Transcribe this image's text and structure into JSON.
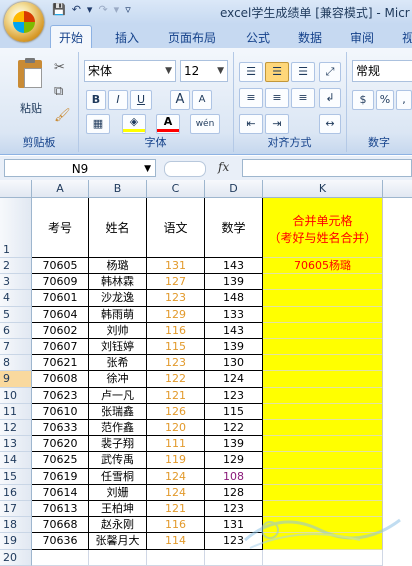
{
  "window": {
    "title": "excel学生成绩单 [兼容模式] - Micr"
  },
  "ribbon": {
    "tabs": [
      "开始",
      "插入",
      "页面布局",
      "公式",
      "数据",
      "审阅",
      "视"
    ],
    "clipboard": {
      "paste": "粘贴",
      "label": "剪贴板"
    },
    "font": {
      "name": "宋体",
      "size": "12",
      "bold": "B",
      "italic": "I",
      "underline": "U",
      "grow": "A",
      "shrink": "A",
      "font_color": "A",
      "phonetic": "wén",
      "label": "字体"
    },
    "alignment": {
      "label": "对齐方式"
    },
    "number": {
      "format": "常规",
      "label": "数字",
      "percent": "%",
      "comma": ",",
      "currency": "$"
    }
  },
  "formula_bar": {
    "name_box": "N9",
    "fx": "fx",
    "formula": ""
  },
  "sheet": {
    "columns": [
      "A",
      "B",
      "C",
      "D",
      "K"
    ],
    "header_row": {
      "A": "考号",
      "B": "姓名",
      "C": "语文",
      "D": "数学",
      "K_line1": "合并单元格",
      "K_line2": "（考好与姓名合并）"
    },
    "row_numbers": [
      "1",
      "2",
      "3",
      "4",
      "5",
      "6",
      "7",
      "8",
      "9",
      "10",
      "11",
      "12",
      "13",
      "14",
      "15",
      "16",
      "17",
      "18",
      "19",
      "20"
    ],
    "selected_row": "9",
    "rows": [
      {
        "A": "70605",
        "B": "杨璐",
        "C": "131",
        "D": "143",
        "K": "70605杨璐"
      },
      {
        "A": "70609",
        "B": "韩林霖",
        "C": "127",
        "D": "139",
        "K": ""
      },
      {
        "A": "70601",
        "B": "沙龙逸",
        "C": "123",
        "D": "148",
        "K": ""
      },
      {
        "A": "70604",
        "B": "韩雨萌",
        "C": "129",
        "D": "133",
        "K": ""
      },
      {
        "A": "70602",
        "B": "刘帅",
        "C": "116",
        "D": "143",
        "K": ""
      },
      {
        "A": "70607",
        "B": "刘钰婷",
        "C": "115",
        "D": "139",
        "K": ""
      },
      {
        "A": "70621",
        "B": "张希",
        "C": "123",
        "D": "130",
        "K": ""
      },
      {
        "A": "70608",
        "B": "徐冲",
        "C": "122",
        "D": "124",
        "K": ""
      },
      {
        "A": "70623",
        "B": "卢一凡",
        "C": "121",
        "D": "123",
        "K": ""
      },
      {
        "A": "70610",
        "B": "张瑞鑫",
        "C": "126",
        "D": "115",
        "K": ""
      },
      {
        "A": "70633",
        "B": "范作鑫",
        "C": "120",
        "D": "122",
        "K": ""
      },
      {
        "A": "70620",
        "B": "裴子翔",
        "C": "111",
        "D": "139",
        "K": ""
      },
      {
        "A": "70625",
        "B": "武传禹",
        "C": "119",
        "D": "129",
        "K": ""
      },
      {
        "A": "70619",
        "B": "任雪桐",
        "C": "124",
        "D": "108",
        "K": ""
      },
      {
        "A": "70614",
        "B": "刘姗",
        "C": "124",
        "D": "128",
        "K": ""
      },
      {
        "A": "70613",
        "B": "王柏坤",
        "C": "121",
        "D": "123",
        "K": ""
      },
      {
        "A": "70668",
        "B": "赵永刚",
        "C": "116",
        "D": "131",
        "K": ""
      },
      {
        "A": "70636",
        "B": "张馨月大",
        "C": "114",
        "D": "123",
        "K": ""
      }
    ]
  },
  "colors": {
    "accent": "#ffff00",
    "c_score": "#e29a2c",
    "low_math": "#8a1a7a",
    "merged_text": "#ff0000"
  }
}
